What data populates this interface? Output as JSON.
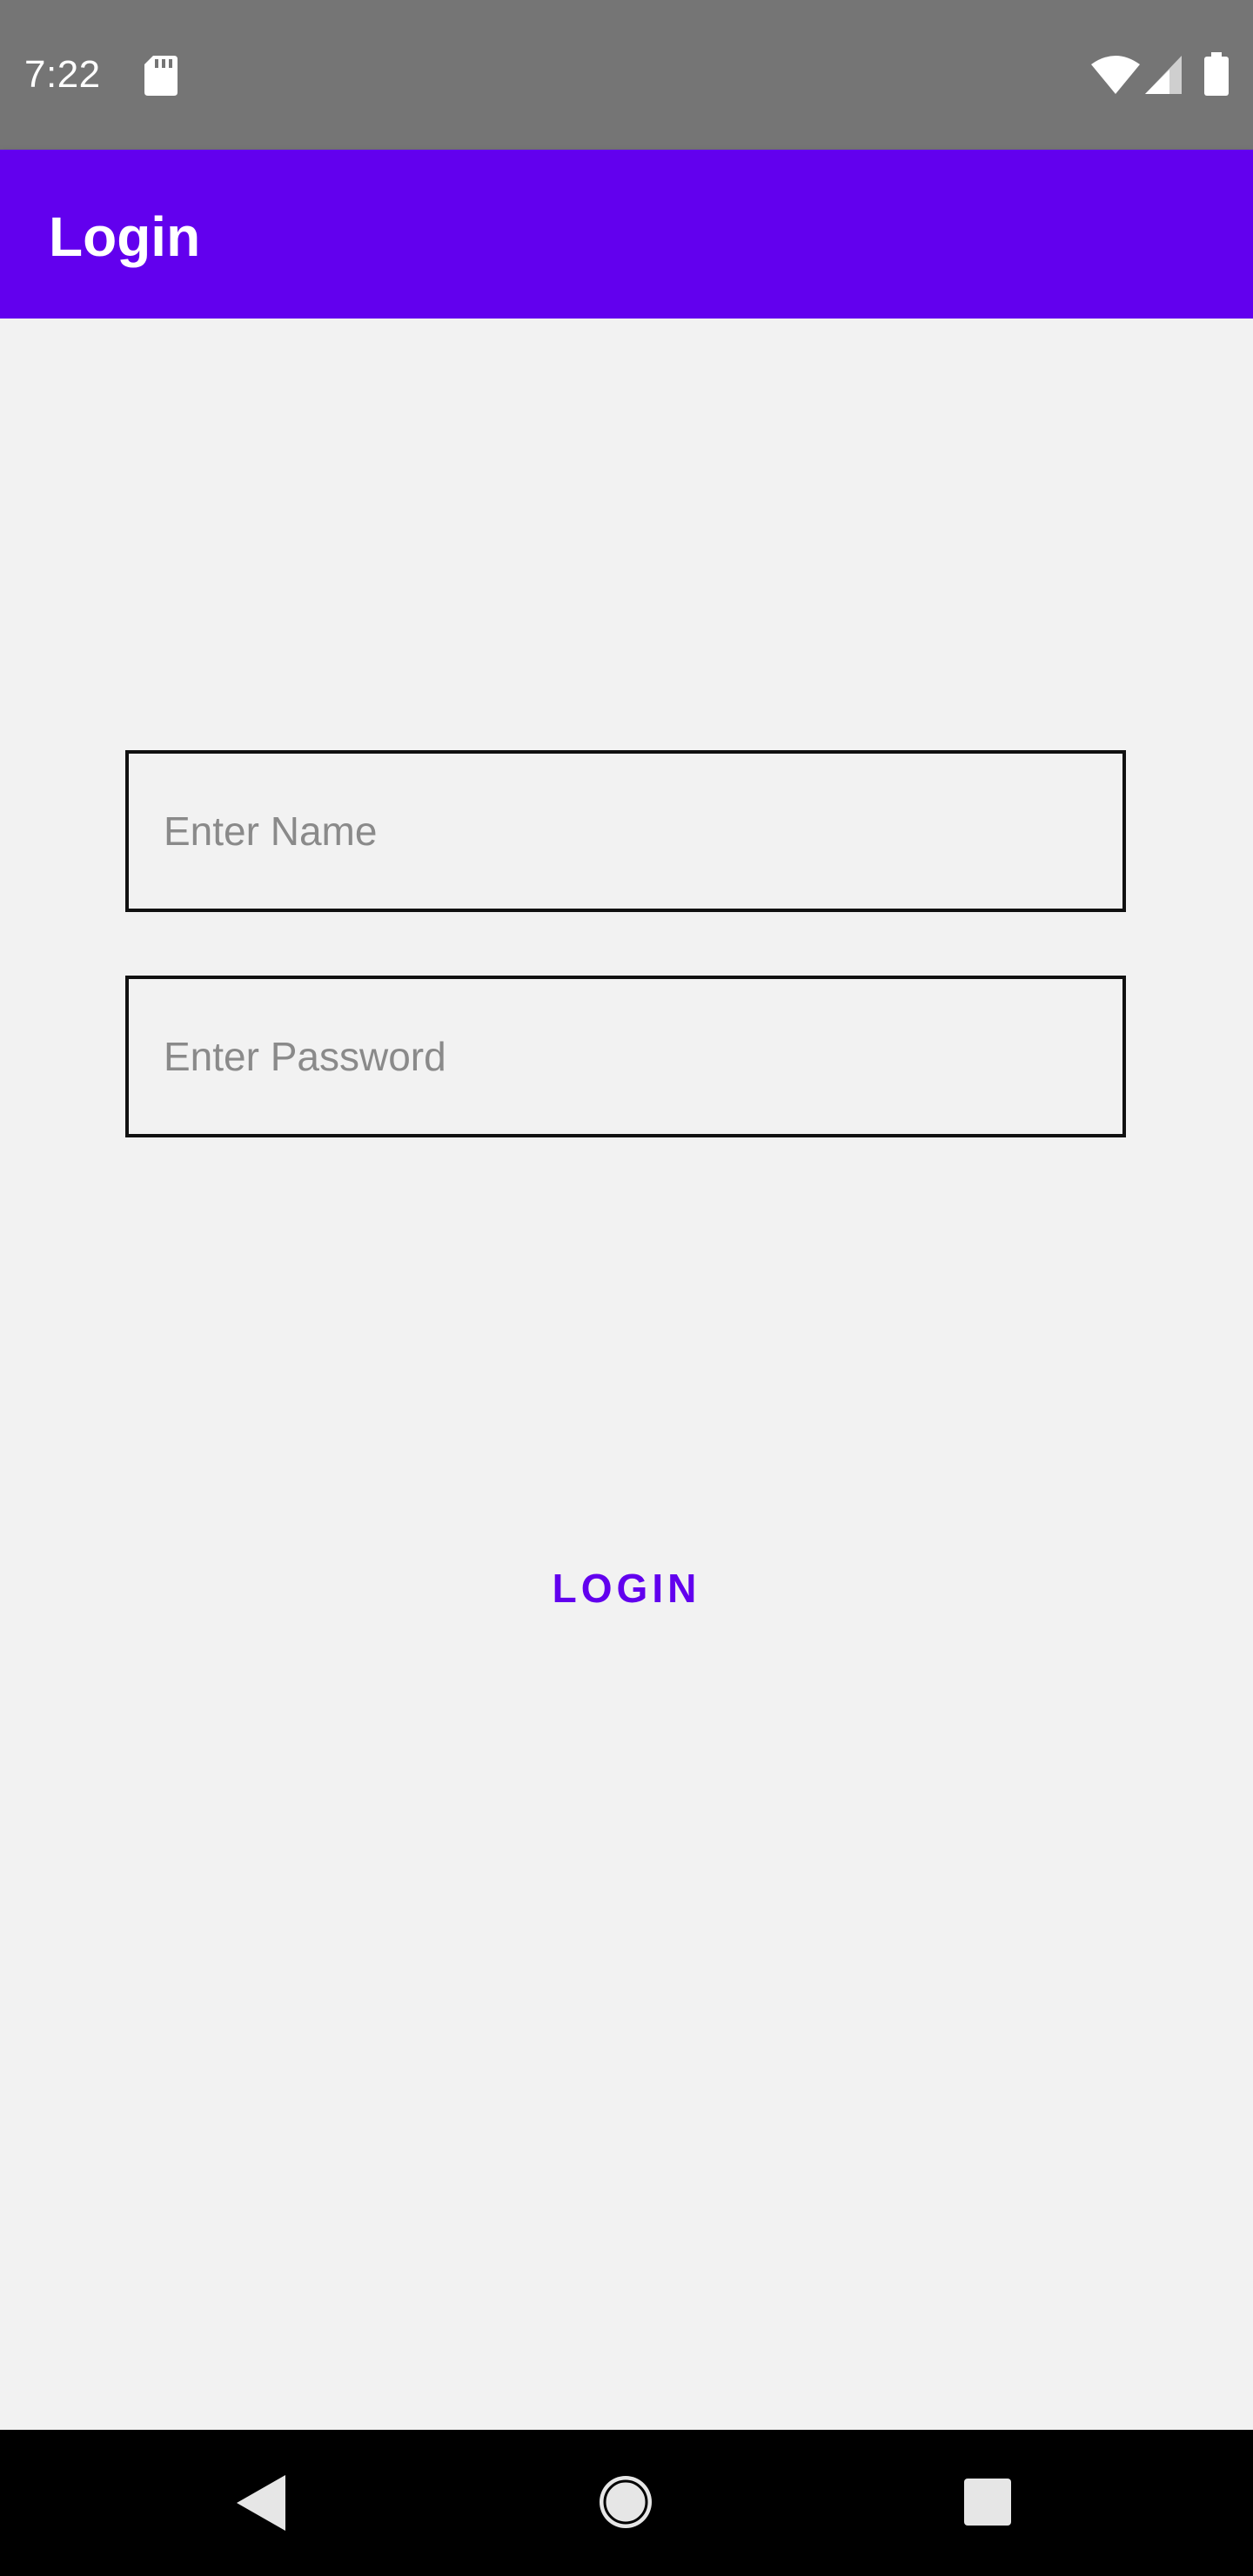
{
  "status_bar": {
    "time": "7:22",
    "icons": [
      "sd-card-icon",
      "wifi-icon",
      "cell-signal-icon",
      "battery-icon"
    ]
  },
  "app_bar": {
    "title": "Login",
    "color": "#6200ee"
  },
  "form": {
    "name_placeholder": "Enter Name",
    "name_value": "",
    "password_placeholder": "Enter Password",
    "password_value": "",
    "login_label": "LOGIN"
  },
  "nav_bar": {
    "icons": [
      "back-icon",
      "home-icon",
      "recents-icon"
    ]
  },
  "colors": {
    "accent": "#6200ee",
    "status_bar": "#757575",
    "background": "#f2f2f2",
    "nav_bar": "#000000"
  }
}
